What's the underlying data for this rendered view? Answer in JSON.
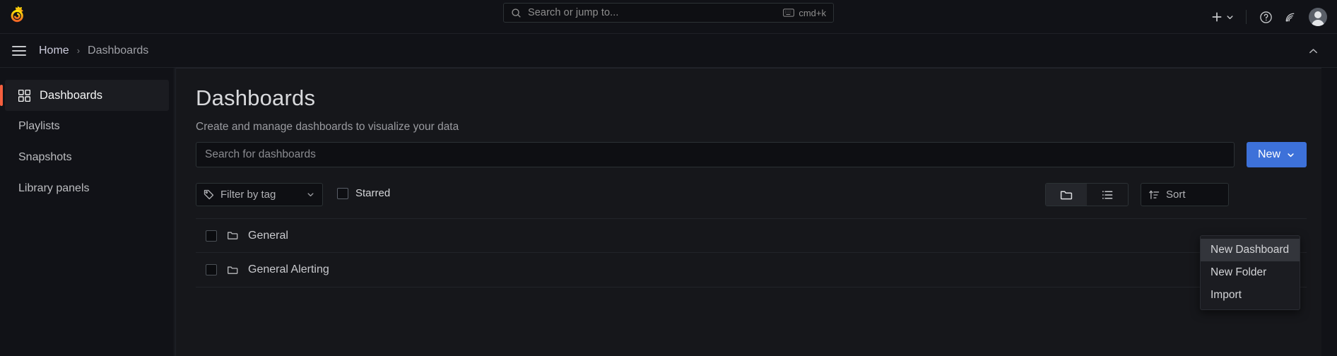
{
  "topbar": {
    "logo_icon": "grafana-logo-icon",
    "search": {
      "placeholder": "Search or jump to...",
      "icon": "search-icon",
      "shortcut": "cmd+k",
      "shortcut_icon": "keyboard-icon"
    },
    "actions": {
      "new_icon": "plus-icon",
      "new_caret_icon": "chevron-down-icon",
      "help_icon": "help-circle-icon",
      "news_icon": "rss-feed-icon",
      "avatar_icon": "user-avatar-icon"
    }
  },
  "breadcrumbbar": {
    "menu_icon": "hamburger-menu-icon",
    "items": [
      {
        "label": "Home"
      },
      {
        "label": "Dashboards"
      }
    ],
    "separator": "›",
    "collapse_icon": "chevron-up-icon"
  },
  "sidebar": {
    "items": [
      {
        "label": "Dashboards",
        "icon": "apps-grid-icon",
        "active": true
      },
      {
        "label": "Playlists",
        "icon": "",
        "active": false
      },
      {
        "label": "Snapshots",
        "icon": "",
        "active": false
      },
      {
        "label": "Library panels",
        "icon": "",
        "active": false
      }
    ],
    "accent_color": "#f55f3e"
  },
  "main": {
    "title": "Dashboards",
    "subtitle": "Create and manage dashboards to visualize your data",
    "search": {
      "placeholder": "Search for dashboards",
      "value": ""
    },
    "new_button": {
      "label": "New",
      "caret_icon": "chevron-down-icon",
      "color": "#3d71d9"
    },
    "menu": {
      "items": [
        {
          "label": "New Dashboard",
          "hovered": true
        },
        {
          "label": "New Folder",
          "hovered": false
        },
        {
          "label": "Import",
          "hovered": false
        }
      ]
    },
    "filters": {
      "tag_filter": {
        "label": "Filter by tag",
        "icon": "tag-icon",
        "caret_icon": "chevron-down-icon"
      },
      "starred": {
        "label": "Starred",
        "checked": false
      },
      "view_toggle": {
        "folder_icon": "folder-view-icon",
        "list_icon": "flat-list-view-icon",
        "active": "folder"
      },
      "sort": {
        "label": "Sort",
        "icon": "sort-ascending-icon"
      }
    },
    "folders": [
      {
        "name": "General",
        "icon": "folder-icon",
        "checked": false,
        "expandable": false
      },
      {
        "name": "General Alerting",
        "icon": "folder-icon",
        "checked": false,
        "expandable": true,
        "caret_icon": "chevron-down-icon"
      }
    ]
  }
}
